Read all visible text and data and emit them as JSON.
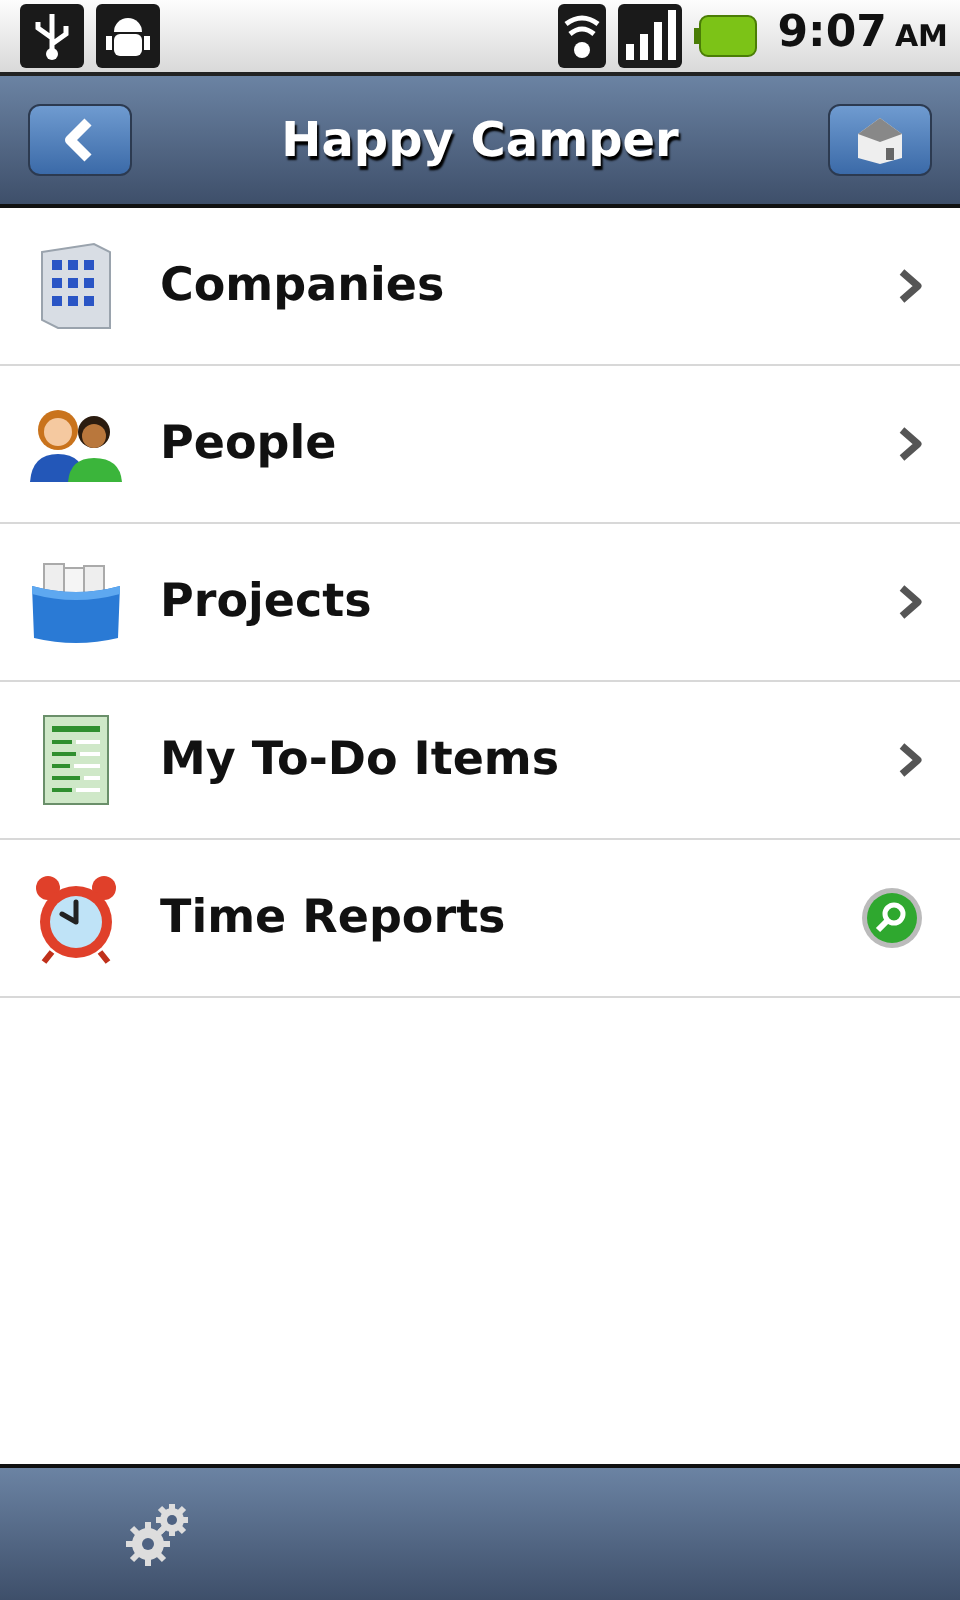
{
  "status_bar": {
    "time": "9:07",
    "meridiem": "AM"
  },
  "header": {
    "title": "Happy Camper"
  },
  "menu": [
    {
      "label": "Companies",
      "kind": "building",
      "accessory": {
        "kind": "chevron"
      }
    },
    {
      "label": "People",
      "kind": "people",
      "accessory": {
        "kind": "chevron"
      }
    },
    {
      "label": "Projects",
      "kind": "folder",
      "accessory": {
        "kind": "chevron"
      }
    },
    {
      "label": "My To-Do Items",
      "kind": "document",
      "accessory": {
        "kind": "chevron"
      }
    },
    {
      "label": "Time Reports",
      "kind": "clock",
      "accessory": {
        "kind": "search"
      }
    }
  ]
}
